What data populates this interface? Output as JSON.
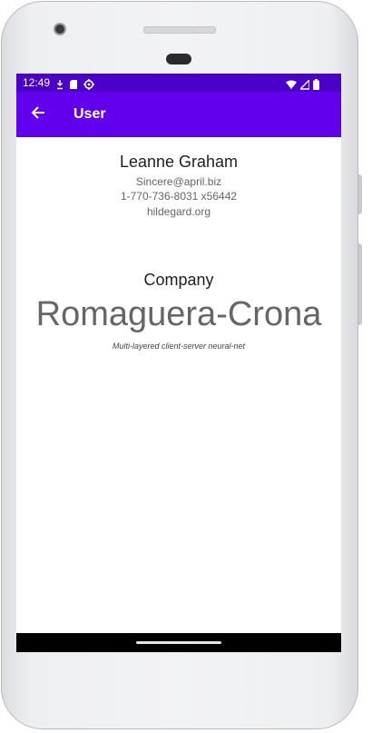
{
  "status_bar": {
    "time": "12:49",
    "left_icons": [
      "download-icon",
      "sd-card-icon",
      "settings-icon"
    ],
    "right_icons": [
      "wifi-icon",
      "signal-icon",
      "battery-icon"
    ]
  },
  "app_bar": {
    "title": "User",
    "back_icon": "arrow-back-icon",
    "color": "#6200ee",
    "status_color": "#4b00c8"
  },
  "user": {
    "name": "Leanne Graham",
    "email": "Sincere@april.biz",
    "phone": "1-770-736-8031 x56442",
    "website": "hildegard.org"
  },
  "company": {
    "heading": "Company",
    "name": "Romaguera-Crona",
    "catch_phrase": "Multi-layered client-server neural-net"
  }
}
